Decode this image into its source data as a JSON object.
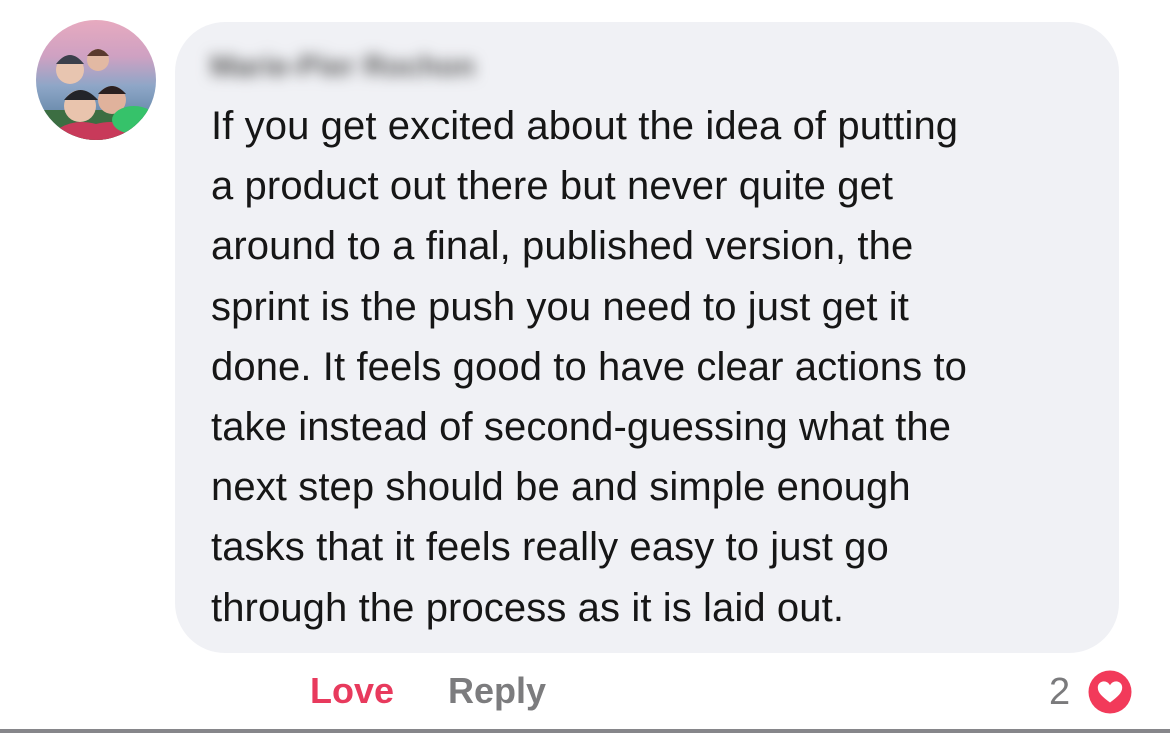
{
  "comment": {
    "author_name": "Marie-Pier Rochon",
    "text_lines": [
      "If you get excited about the idea of putting",
      "a product out there but never quite get",
      "around to a final, published version, the",
      "sprint is the push you need to just get it",
      "done. It feels good to have clear actions to",
      "take instead of second-guessing what the",
      "next step should be and simple enough",
      "tasks that it feels really easy to just go",
      "through the process as it is laid out."
    ]
  },
  "actions": {
    "love_label": "Love",
    "reply_label": "Reply"
  },
  "reactions": {
    "count": "2",
    "icon": "heart-icon"
  },
  "colors": {
    "bubble_background": "#f0f1f5",
    "love_accent": "#e83a5d",
    "reply_text": "#7c7c7e",
    "text": "#161616"
  }
}
